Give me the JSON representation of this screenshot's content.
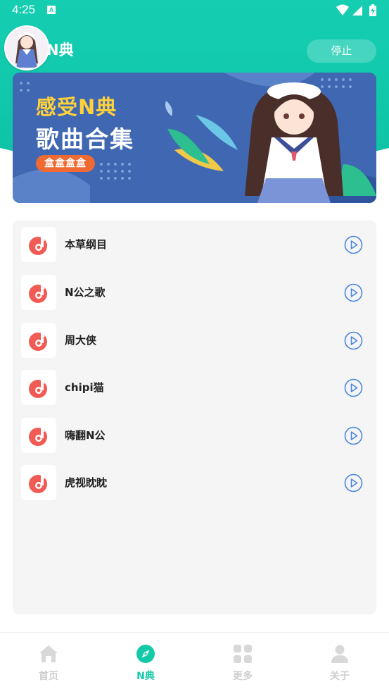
{
  "status_bar": {
    "time": "4:25",
    "notification_icon_letter": "A"
  },
  "header": {
    "title": "N典",
    "stop_label": "停止"
  },
  "banner": {
    "line1": "感受N典",
    "line2": "歌曲合集",
    "tag": "盒盒盒盒"
  },
  "songs": [
    {
      "title": "本草纲目"
    },
    {
      "title": "N公之歌"
    },
    {
      "title": "周大侠"
    },
    {
      "title": "chipi猫"
    },
    {
      "title": "嗨翻N公"
    },
    {
      "title": "虎视眈眈"
    }
  ],
  "nav": [
    {
      "label": "首页",
      "icon": "home-icon",
      "active": false
    },
    {
      "label": "N典",
      "icon": "compass-icon",
      "active": true
    },
    {
      "label": "更多",
      "icon": "grid-icon",
      "active": false
    },
    {
      "label": "关于",
      "icon": "person-icon",
      "active": false
    }
  ],
  "colors": {
    "accent": "#14c9a8",
    "banner_bg": "#3f67b2",
    "banner_title": "#ffd23a",
    "banner_tag": "#f06a33",
    "music_icon": "#f25a54",
    "play_icon": "#4a86e0",
    "nav_inactive": "#cfcfcf"
  }
}
